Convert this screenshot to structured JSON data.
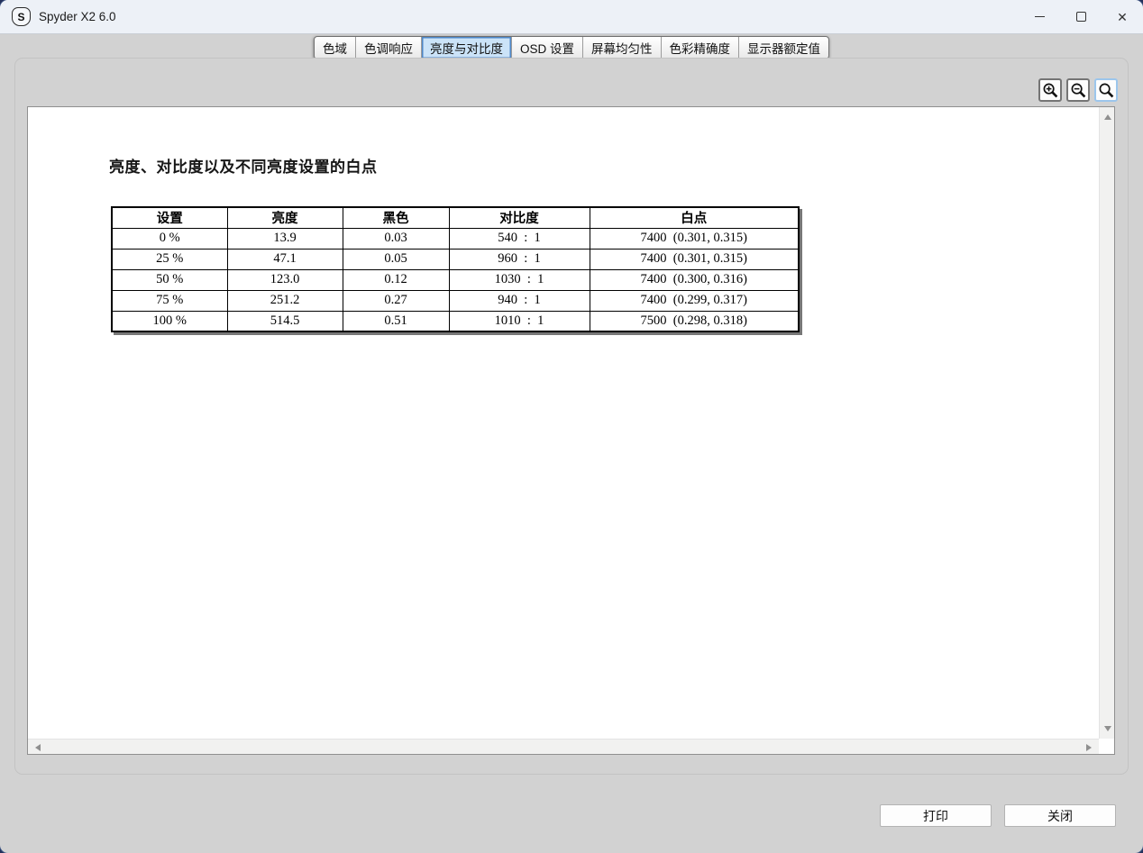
{
  "window": {
    "title": "Spyder X2 6.0",
    "logo_letter": "S"
  },
  "titlebar_icons": {
    "minimize": "minimize-icon",
    "maximize": "maximize-icon",
    "close": "close-icon ✕"
  },
  "tabs": [
    {
      "label": "色域",
      "selected": false
    },
    {
      "label": "色调响应",
      "selected": false
    },
    {
      "label": "亮度与对比度",
      "selected": true
    },
    {
      "label": "OSD 设置",
      "selected": false
    },
    {
      "label": "屏幕均匀性",
      "selected": false
    },
    {
      "label": "色彩精确度",
      "selected": false
    },
    {
      "label": "显示器额定值",
      "selected": false
    }
  ],
  "toolbar": {
    "zoom_in_icon": "magnifier-plus",
    "zoom_out_icon": "magnifier-minus",
    "zoom_reset_icon": "magnifier",
    "active_tool": "zoom_reset"
  },
  "report": {
    "title": "亮度、对比度以及不同亮度设置的白点",
    "table": {
      "headers": [
        "设置",
        "亮度",
        "黑色",
        "对比度",
        "白点"
      ],
      "rows": [
        [
          "0 %",
          "13.9",
          "0.03",
          "540  :  1",
          "7400  (0.301, 0.315)"
        ],
        [
          "25 %",
          "47.1",
          "0.05",
          "960  :  1",
          "7400  (0.301, 0.315)"
        ],
        [
          "50 %",
          "123.0",
          "0.12",
          "1030  :  1",
          "7400  (0.300, 0.316)"
        ],
        [
          "75 %",
          "251.2",
          "0.27",
          "940  :  1",
          "7400  (0.299, 0.317)"
        ],
        [
          "100 %",
          "514.5",
          "0.51",
          "1010  :  1",
          "7500  (0.298, 0.318)"
        ]
      ]
    }
  },
  "footer": {
    "print_label": "打印",
    "close_label": "关闭"
  },
  "colors": {
    "titlebar_bg": "#edf1f7",
    "body_bg": "#d2d2d2",
    "desktop_bg": "#22305a",
    "tab_selected_bg": "#cbe3f8",
    "tab_selected_border": "#4d86c6",
    "zoom_active_border": "#9cc6ec",
    "table_border": "#000000",
    "table_shadow": "#777777"
  }
}
